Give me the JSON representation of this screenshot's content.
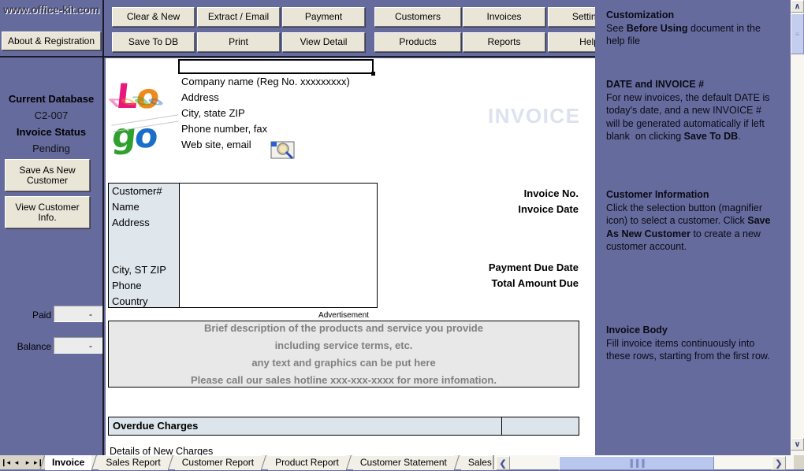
{
  "brand": {
    "site": "www.office-kit.com",
    "about_button": "About & Registration"
  },
  "toolbar": {
    "buttons": [
      {
        "label": "Clear & New"
      },
      {
        "label": "Extract / Email"
      },
      {
        "label": "Payment"
      },
      {
        "label": "Customers"
      },
      {
        "label": "Invoices"
      },
      {
        "label": "Settings"
      },
      {
        "label": "Save To DB"
      },
      {
        "label": "Print"
      },
      {
        "label": "View Detail"
      },
      {
        "label": "Products"
      },
      {
        "label": "Reports"
      },
      {
        "label": "Help"
      }
    ]
  },
  "sidebar": {
    "current_database_label": "Current Database",
    "current_database_value": "C2-007",
    "invoice_status_label": "Invoice Status",
    "invoice_status_value": "Pending",
    "save_as_new_customer": "Save As New Customer",
    "view_customer_info": "View Customer Info.",
    "paid_label": "Paid",
    "paid_value": "-",
    "balance_label": "Balance",
    "balance_value": "-"
  },
  "sheet": {
    "logo_text": "Logo",
    "company": [
      "Company name (Reg No. xxxxxxxxx)",
      "Address",
      "City, state ZIP",
      "Phone number, fax",
      "Web site, email"
    ],
    "invoice_watermark": "INVOICE",
    "customer_labels": [
      "Customer#",
      "Name",
      "Address",
      "",
      "",
      "City, ST ZIP",
      "Phone",
      "Country"
    ],
    "invoice_no_label": "Invoice No.",
    "invoice_date_label": "Invoice Date",
    "payment_due_date_label": "Payment Due Date",
    "total_amount_due_label": "Total Amount Due",
    "advertisement_caption": "Advertisement",
    "advertisement_lines": [
      "Brief description of the products and service you provide",
      "including service terms, etc.",
      "any text and graphics can be put here",
      "Please call our sales hotline xxx-xxx-xxxx for more infomation."
    ],
    "overdue_charges_label": "Overdue Charges",
    "overdue_charges_value": "",
    "details_of_new_charges_label": "Details of New Charges"
  },
  "help": [
    {
      "title": "Customization",
      "body_html": "See <b>Before Using</b> document in the help file"
    },
    {
      "title": "DATE and INVOICE #",
      "body_html": "For new invoices, the default DATE is today's date, and a new INVOICE # will be generated automatically if left blank&nbsp; on clicking <b>Save To DB</b>."
    },
    {
      "title": "Customer Information",
      "body_html": "Click the selection button (magnifier icon) to select a customer. Click <b>Save As New Customer</b> to create a new customer account."
    },
    {
      "title": "Invoice Body",
      "body_html": "Fill invoice items continuously into these rows, starting from the first row."
    }
  ],
  "tabbar": {
    "nav_first": "❙◂",
    "nav_prev": "◂",
    "nav_next": "▸",
    "nav_last": "▸❙",
    "tabs": [
      {
        "label": "Invoice",
        "active": true
      },
      {
        "label": "Sales Report",
        "active": false
      },
      {
        "label": "Customer Report",
        "active": false
      },
      {
        "label": "Product Report",
        "active": false
      },
      {
        "label": "Customer Statement",
        "active": false
      },
      {
        "label": "Sales",
        "active": false
      }
    ]
  },
  "scrollbars": {
    "h_left_arrow": "❮",
    "h_right_arrow": "❯",
    "h_thumb_grip": "▐▐▐",
    "v_up_arrow": "∧",
    "v_down_arrow": "∨",
    "v_thumb_grip": "≡"
  },
  "colors": {
    "app_background": "#666b9e",
    "button_face": "#e9e6d8",
    "sheet": "#ffffff",
    "label_column": "#dfe6ec",
    "ad_box": "#e8e8e8",
    "ad_text": "#808080",
    "overdue_row": "#dce5ec",
    "watermark": "#dce2ee",
    "tab_inactive": "#f1efe6",
    "tab_active": "#ffffff",
    "scroll_thumb": "#b9c6ee"
  }
}
